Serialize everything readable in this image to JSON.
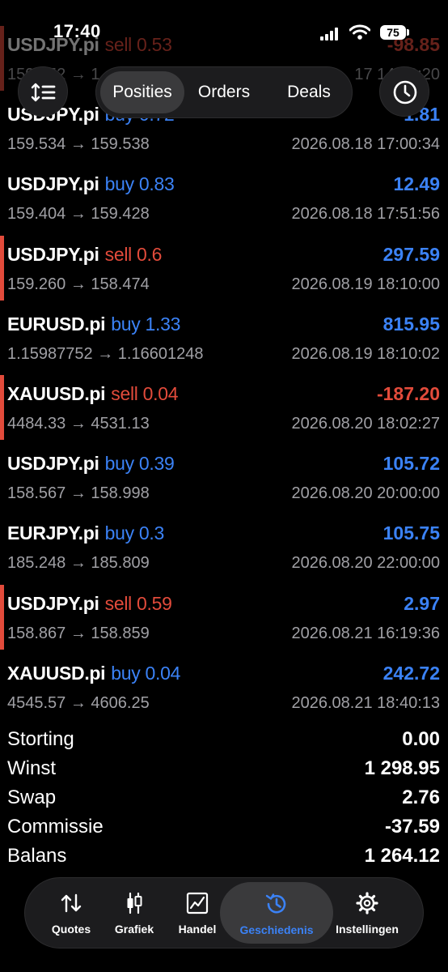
{
  "status_bar": {
    "time": "17:40",
    "battery": "75"
  },
  "segments": [
    "Posities",
    "Orders",
    "Deals"
  ],
  "deals": [
    {
      "symbol": "USDJPY.pi",
      "side": "sell",
      "volume": "0.53",
      "profit": "-98.85",
      "prices": "159.752 → 1",
      "time": "17 14:00:20"
    },
    {
      "symbol": "USDJPY.pi",
      "side": "buy",
      "volume": "0.72",
      "profit": "1.81",
      "prices": "159.534 → 159.538",
      "time": "2026.08.18 17:00:34"
    },
    {
      "symbol": "USDJPY.pi",
      "side": "buy",
      "volume": "0.83",
      "profit": "12.49",
      "prices": "159.404 → 159.428",
      "time": "2026.08.18 17:51:56"
    },
    {
      "symbol": "USDJPY.pi",
      "side": "sell",
      "volume": "0.6",
      "profit": "297.59",
      "prices": "159.260 → 158.474",
      "time": "2026.08.19 18:10:00"
    },
    {
      "symbol": "EURUSD.pi",
      "side": "buy",
      "volume": "1.33",
      "profit": "815.95",
      "prices": "1.15987752 → 1.16601248",
      "time": "2026.08.19 18:10:02"
    },
    {
      "symbol": "XAUUSD.pi",
      "side": "sell",
      "volume": "0.04",
      "profit": "-187.20",
      "prices": "4484.33 → 4531.13",
      "time": "2026.08.20 18:02:27"
    },
    {
      "symbol": "USDJPY.pi",
      "side": "buy",
      "volume": "0.39",
      "profit": "105.72",
      "prices": "158.567 → 158.998",
      "time": "2026.08.20 20:00:00"
    },
    {
      "symbol": "EURJPY.pi",
      "side": "buy",
      "volume": "0.3",
      "profit": "105.75",
      "prices": "185.248 → 185.809",
      "time": "2026.08.20 22:00:00"
    },
    {
      "symbol": "USDJPY.pi",
      "side": "sell",
      "volume": "0.59",
      "profit": "2.97",
      "prices": "158.867 → 158.859",
      "time": "2026.08.21 16:19:36"
    },
    {
      "symbol": "XAUUSD.pi",
      "side": "buy",
      "volume": "0.04",
      "profit": "242.72",
      "prices": "4545.57 → 4606.25",
      "time": "2026.08.21 18:40:13"
    }
  ],
  "summary": [
    {
      "label": "Storting",
      "value": "0.00"
    },
    {
      "label": "Winst",
      "value": "1 298.95"
    },
    {
      "label": "Swap",
      "value": "2.76"
    },
    {
      "label": "Commissie",
      "value": "-37.59"
    },
    {
      "label": "Balans",
      "value": "1 264.12"
    }
  ],
  "tabs": [
    {
      "label": "Quotes",
      "icon": "quotes-arrows-icon"
    },
    {
      "label": "Grafiek",
      "icon": "candlestick-icon"
    },
    {
      "label": "Handel",
      "icon": "trade-chart-icon"
    },
    {
      "label": "Geschiedenis",
      "icon": "history-clock-icon"
    },
    {
      "label": "Instellingen",
      "icon": "gear-icon"
    }
  ],
  "colors": {
    "buy": "#3b82f6",
    "sell": "#e24b3b",
    "muted": "#a0a0a5",
    "active_tab": "#3b82f6"
  }
}
